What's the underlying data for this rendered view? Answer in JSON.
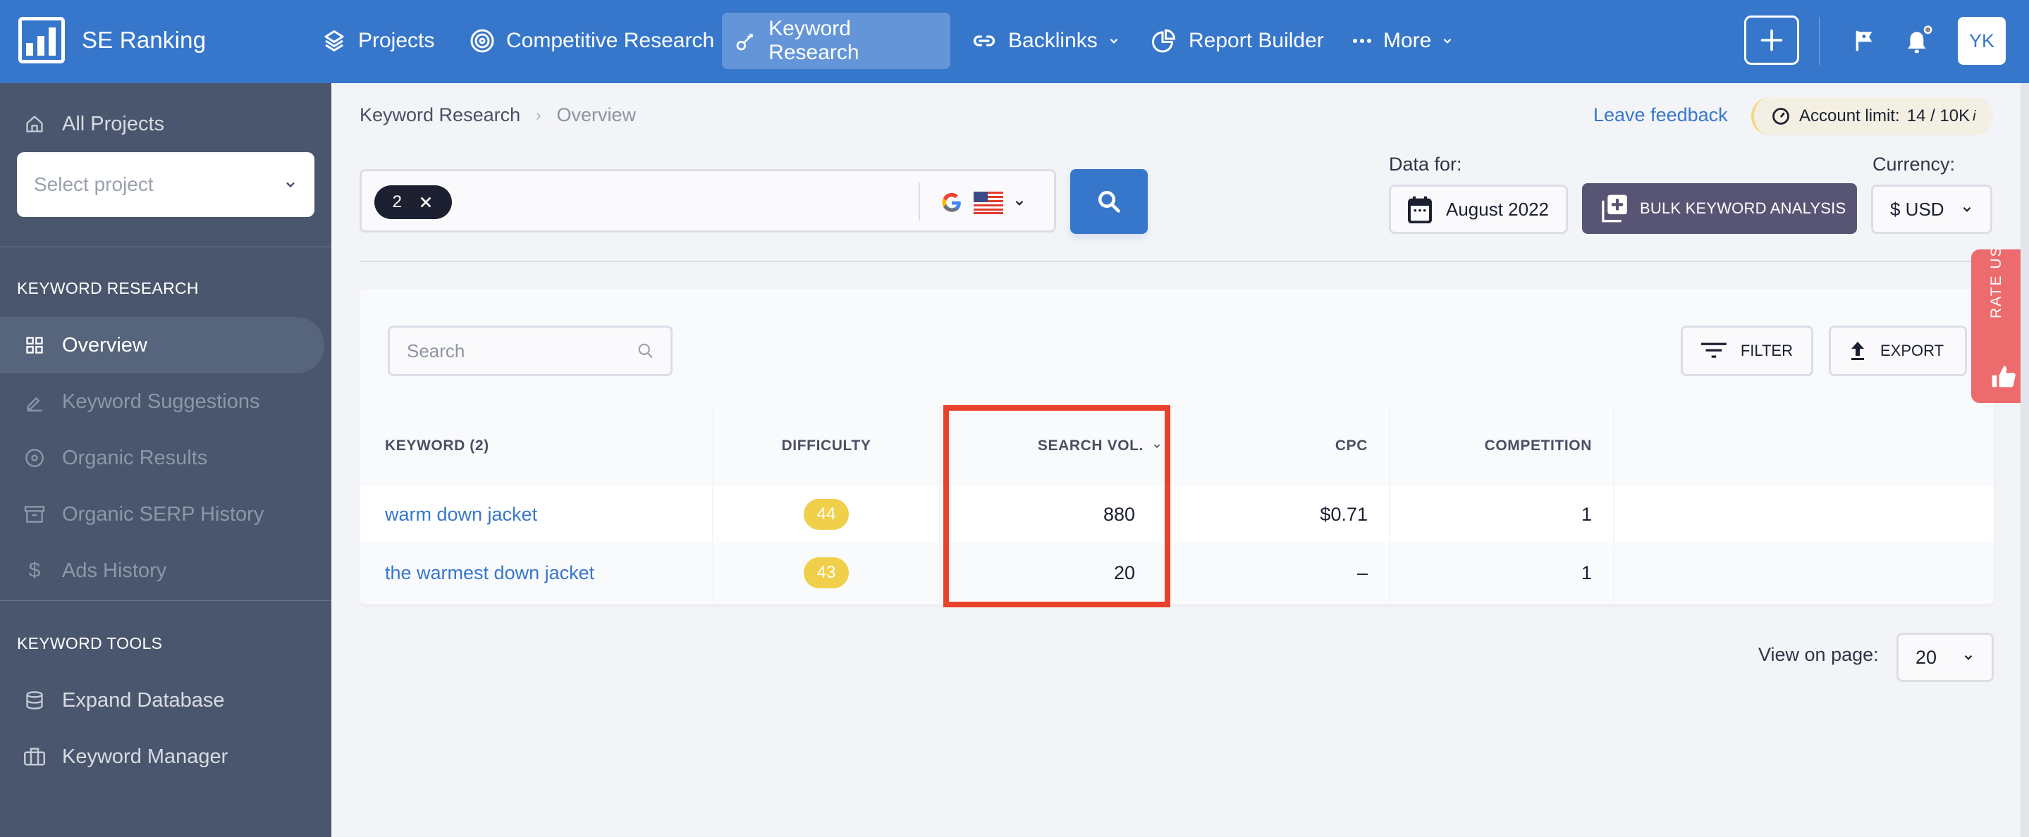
{
  "topnav": {
    "brand": "SE Ranking",
    "items": [
      {
        "label": "Projects",
        "icon": "layers-icon",
        "active": false
      },
      {
        "label": "Competitive Research",
        "icon": "target-icon",
        "active": false
      },
      {
        "label": "Keyword Research",
        "icon": "key-icon",
        "active": true
      },
      {
        "label": "Backlinks",
        "icon": "link-icon",
        "active": false,
        "dropdown": true
      },
      {
        "label": "Report Builder",
        "icon": "pie-chart-icon",
        "active": false
      },
      {
        "label": "More",
        "icon": "more-dots-icon",
        "active": false,
        "dropdown": true
      }
    ],
    "avatar_initials": "YK"
  },
  "sidebar": {
    "all_projects": "All Projects",
    "select_project_placeholder": "Select project",
    "sections": [
      {
        "heading": "KEYWORD RESEARCH",
        "items": [
          {
            "label": "Overview",
            "icon": "grid-icon",
            "active": true
          },
          {
            "label": "Keyword Suggestions",
            "icon": "pencil-icon",
            "active": false
          },
          {
            "label": "Organic Results",
            "icon": "eye-icon",
            "active": false
          },
          {
            "label": "Organic SERP History",
            "icon": "archive-icon",
            "active": false
          },
          {
            "label": "Ads History",
            "icon": "dollar-icon",
            "active": false
          }
        ]
      },
      {
        "heading": "KEYWORD TOOLS",
        "items": [
          {
            "label": "Expand Database",
            "icon": "database-icon",
            "active": false
          },
          {
            "label": "Keyword Manager",
            "icon": "briefcase-icon",
            "active": false
          }
        ]
      }
    ]
  },
  "breadcrumb": [
    "Keyword Research",
    "Overview"
  ],
  "feedback_link": "Leave feedback",
  "account_limit": {
    "label": "Account limit:",
    "value": "14 / 10K",
    "info": "i"
  },
  "keyword_input": {
    "chip_count": "2",
    "search_engine": "Google",
    "country": "United States"
  },
  "data_for": {
    "label": "Data for:",
    "value": "August 2022"
  },
  "bulk_button": "BULK KEYWORD ANALYSIS",
  "currency": {
    "label": "Currency:",
    "value": "$ USD"
  },
  "rate_us": "RATE US",
  "table": {
    "search_placeholder": "Search",
    "filter_label": "FILTER",
    "export_label": "EXPORT",
    "columns": [
      "KEYWORD  (2)",
      "DIFFICULTY",
      "SEARCH VOL.",
      "CPC",
      "COMPETITION"
    ],
    "sorted_column": "SEARCH VOL.",
    "rows": [
      {
        "keyword": "warm down jacket",
        "difficulty": "44",
        "search_volume": "880",
        "cpc": "$0.71",
        "competition": "1"
      },
      {
        "keyword": "the warmest down jacket",
        "difficulty": "43",
        "search_volume": "20",
        "cpc": "–",
        "competition": "1"
      }
    ]
  },
  "pagination": {
    "label": "View on page:",
    "value": "20"
  },
  "colors": {
    "primary": "#3777cb",
    "sidebar": "#4a566d",
    "bulk_button": "#585574",
    "difficulty_badge": "#f0cf4a",
    "highlight_box": "#e8432a",
    "rate_us": "#ec6b6d"
  }
}
